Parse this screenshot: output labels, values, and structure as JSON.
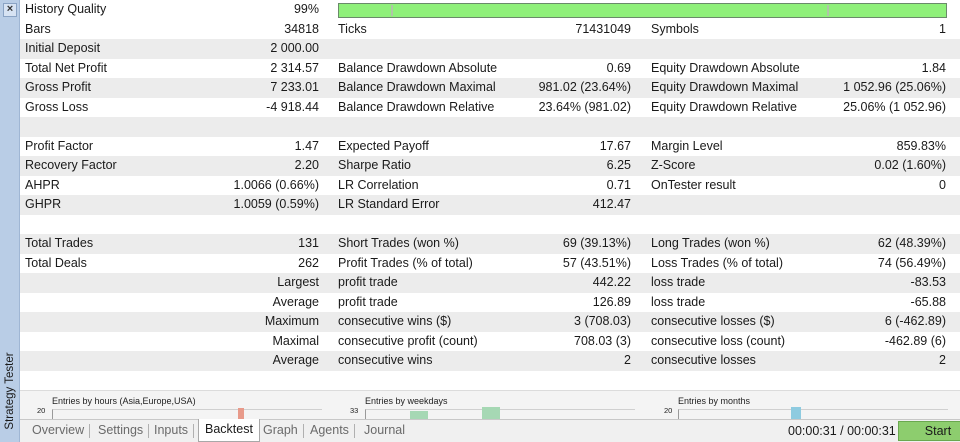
{
  "panel": {
    "close_label": "×",
    "title": "Strategy Tester"
  },
  "quality": {
    "label": "History Quality",
    "value": "99%",
    "fraction": 0.99
  },
  "rows": [
    {
      "shade": false,
      "cells": [
        [
          "Bars",
          "34818"
        ],
        [
          "Ticks",
          "71431049"
        ],
        [
          "Symbols",
          "1"
        ]
      ]
    },
    {
      "shade": true,
      "cells": [
        [
          "Initial Deposit",
          "2 000.00"
        ],
        [
          "",
          ""
        ],
        [
          "",
          ""
        ]
      ]
    },
    {
      "shade": false,
      "cells": [
        [
          "Total Net Profit",
          "2 314.57"
        ],
        [
          "Balance Drawdown Absolute",
          "0.69"
        ],
        [
          "Equity Drawdown Absolute",
          "1.84"
        ]
      ]
    },
    {
      "shade": true,
      "cells": [
        [
          "Gross Profit",
          "7 233.01"
        ],
        [
          "Balance Drawdown Maximal",
          "981.02 (23.64%)"
        ],
        [
          "Equity Drawdown Maximal",
          "1 052.96 (25.06%)"
        ]
      ]
    },
    {
      "shade": false,
      "cells": [
        [
          "Gross Loss",
          "-4 918.44"
        ],
        [
          "Balance Drawdown Relative",
          "23.64% (981.02)"
        ],
        [
          "Equity Drawdown Relative",
          "25.06% (1 052.96)"
        ]
      ]
    },
    {
      "shade": true,
      "cells": [
        [
          "",
          ""
        ],
        [
          "",
          ""
        ],
        [
          "",
          ""
        ]
      ]
    },
    {
      "shade": false,
      "cells": [
        [
          "Profit Factor",
          "1.47"
        ],
        [
          "Expected Payoff",
          "17.67"
        ],
        [
          "Margin Level",
          "859.83%"
        ]
      ]
    },
    {
      "shade": true,
      "cells": [
        [
          "Recovery Factor",
          "2.20"
        ],
        [
          "Sharpe Ratio",
          "6.25"
        ],
        [
          "Z-Score",
          "0.02 (1.60%)"
        ]
      ]
    },
    {
      "shade": false,
      "cells": [
        [
          "AHPR",
          "1.0066 (0.66%)"
        ],
        [
          "LR Correlation",
          "0.71"
        ],
        [
          "OnTester result",
          "0"
        ]
      ]
    },
    {
      "shade": true,
      "cells": [
        [
          "GHPR",
          "1.0059 (0.59%)"
        ],
        [
          "LR Standard Error",
          "412.47"
        ],
        [
          "",
          ""
        ]
      ]
    },
    {
      "shade": false,
      "cells": [
        [
          "",
          ""
        ],
        [
          "",
          ""
        ],
        [
          "",
          ""
        ]
      ]
    },
    {
      "shade": true,
      "cells": [
        [
          "Total Trades",
          "131"
        ],
        [
          "Short Trades (won %)",
          "69 (39.13%)"
        ],
        [
          "Long Trades (won %)",
          "62 (48.39%)"
        ]
      ]
    },
    {
      "shade": false,
      "cells": [
        [
          "Total Deals",
          "262"
        ],
        [
          "Profit Trades (% of total)",
          "57 (43.51%)"
        ],
        [
          "Loss Trades (% of total)",
          "74 (56.49%)"
        ]
      ]
    },
    {
      "shade": true,
      "right_label": true,
      "cells": [
        [
          "Largest",
          ""
        ],
        [
          "profit trade",
          "442.22"
        ],
        [
          "loss trade",
          "-83.53"
        ]
      ]
    },
    {
      "shade": false,
      "right_label": true,
      "cells": [
        [
          "Average",
          ""
        ],
        [
          "profit trade",
          "126.89"
        ],
        [
          "loss trade",
          "-65.88"
        ]
      ]
    },
    {
      "shade": true,
      "right_label": true,
      "cells": [
        [
          "Maximum",
          ""
        ],
        [
          "consecutive wins ($)",
          "3 (708.03)"
        ],
        [
          "consecutive losses ($)",
          "6 (-462.89)"
        ]
      ]
    },
    {
      "shade": false,
      "right_label": true,
      "cells": [
        [
          "Maximal",
          ""
        ],
        [
          "consecutive profit (count)",
          "708.03 (3)"
        ],
        [
          "consecutive loss (count)",
          "-462.89 (6)"
        ]
      ]
    },
    {
      "shade": true,
      "right_label": true,
      "cells": [
        [
          "Average",
          ""
        ],
        [
          "consecutive wins",
          "2"
        ],
        [
          "consecutive losses",
          "2"
        ]
      ]
    }
  ],
  "mini_charts": [
    {
      "title": "Entries by hours (Asia,Europe,USA)",
      "scale": "20",
      "bar_color": "#e89a8a"
    },
    {
      "title": "Entries by weekdays",
      "scale": "33",
      "bar_color": "#a6d8b4"
    },
    {
      "title": "Entries by months",
      "scale": "20",
      "bar_color": "#8ecbe0"
    }
  ],
  "tabs": [
    {
      "label": "Overview",
      "active": false
    },
    {
      "label": "Settings",
      "active": false
    },
    {
      "label": "Inputs",
      "active": false
    },
    {
      "label": "Backtest",
      "active": true
    },
    {
      "label": "Graph",
      "active": false
    },
    {
      "label": "Agents",
      "active": false
    },
    {
      "label": "Journal",
      "active": false
    }
  ],
  "status": {
    "elapsed": "00:00:31 / 00:00:31",
    "start_label": "Start"
  },
  "colors": {
    "quality_bar": "#8ff07a",
    "start_button": "#8dcd6e",
    "panel_strip": "#b9cde6"
  }
}
